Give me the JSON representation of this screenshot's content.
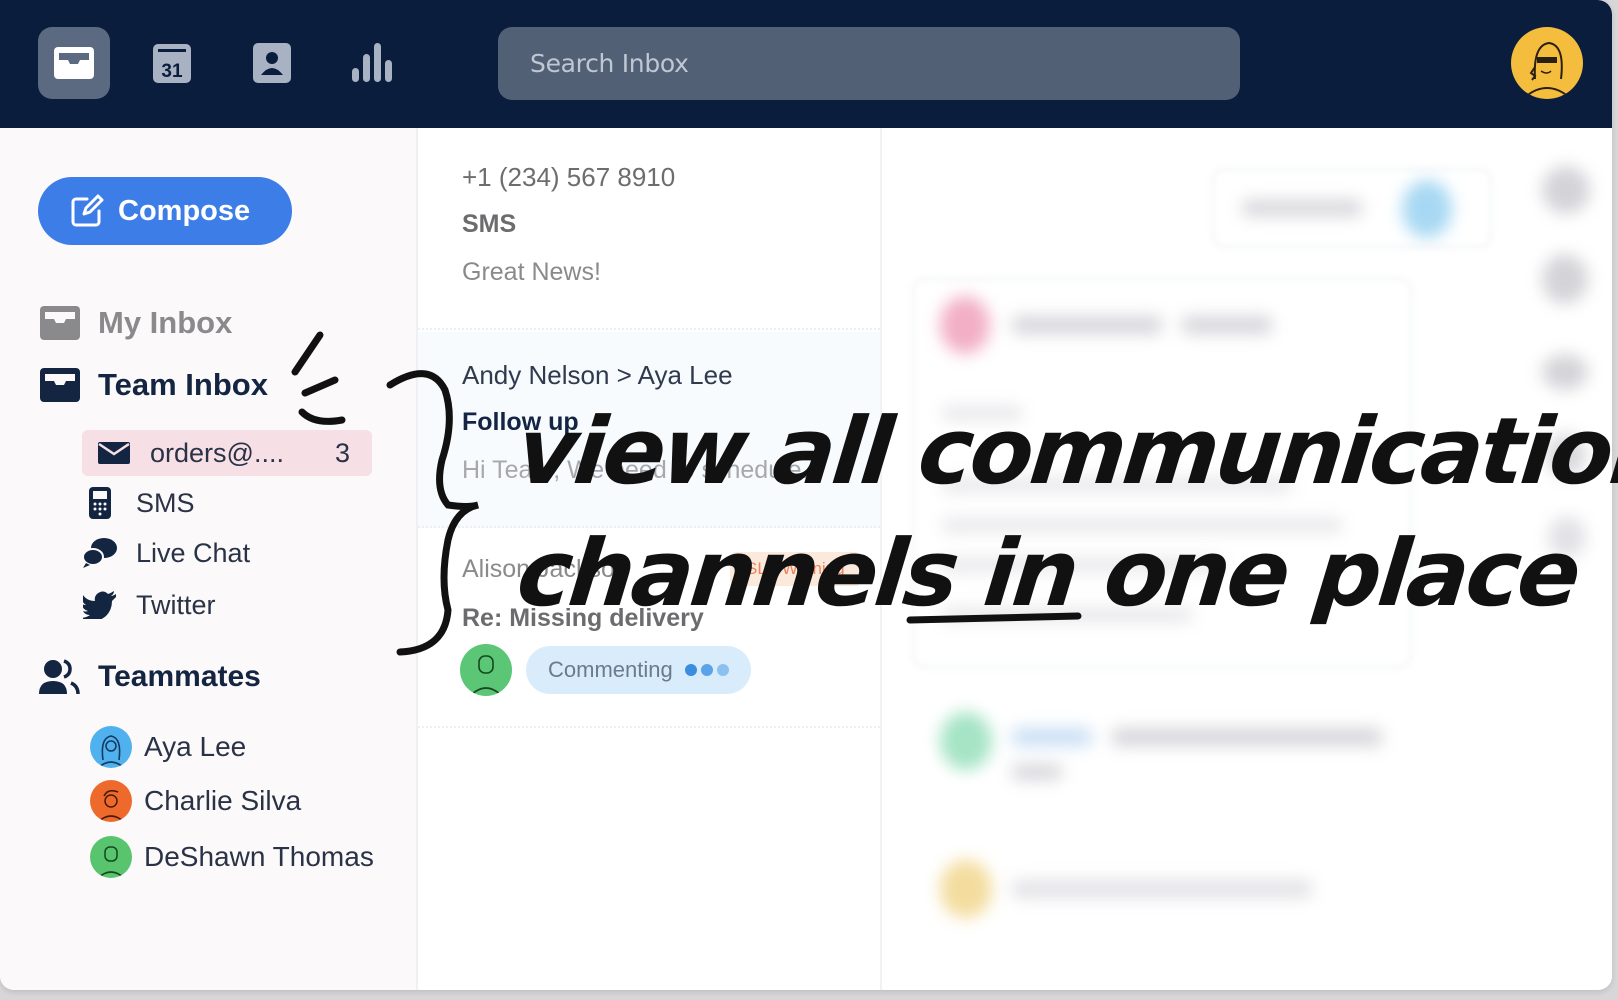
{
  "topbar": {
    "nav": [
      {
        "name": "inbox",
        "icon": "inbox-tray-icon",
        "active": true
      },
      {
        "name": "calendar",
        "icon": "calendar-icon",
        "day": "31",
        "active": false
      },
      {
        "name": "contacts",
        "icon": "contact-card-icon",
        "active": false
      },
      {
        "name": "analytics",
        "icon": "bar-chart-icon",
        "active": false
      }
    ],
    "search_placeholder": "Search Inbox",
    "user_avatar": "user-avatar-sunglasses"
  },
  "sidebar": {
    "compose_label": "Compose",
    "my_inbox_label": "My Inbox",
    "team_inbox_label": "Team Inbox",
    "channels": [
      {
        "label": "orders@....",
        "icon": "envelope-icon",
        "count": "3",
        "selected": true
      },
      {
        "label": "SMS",
        "icon": "phone-icon",
        "count": null,
        "selected": false
      },
      {
        "label": "Live Chat",
        "icon": "chat-bubbles-icon",
        "count": null,
        "selected": false
      },
      {
        "label": "Twitter",
        "icon": "twitter-bird-icon",
        "count": null,
        "selected": false
      }
    ],
    "teammates_label": "Teammates",
    "teammates": [
      {
        "name": "Aya Lee",
        "color": "#4fb2ee"
      },
      {
        "name": "Charlie Silva",
        "color": "#ee6a2c"
      },
      {
        "name": "DeShawn Thomas",
        "color": "#58c46e"
      }
    ]
  },
  "messages": [
    {
      "from": "+1 (234) 567 8910",
      "subject": "SMS",
      "preview": "Great News!"
    },
    {
      "from": "Andy Nelson > Aya Lee",
      "subject": "Follow up",
      "preview": "Hi Team, We need to schedule..."
    },
    {
      "from": "Alison Jackson",
      "subject": "Re: Missing delivery",
      "tag": "SLA Warning",
      "status": "Commenting"
    }
  ],
  "annotation": {
    "line1": "view all communication",
    "line2_a": "channels in ",
    "line2_emph": "one",
    "line2_b": " place"
  },
  "colors": {
    "topbar": "#0b1d3d",
    "accent": "#3d7de8",
    "selected_channel": "#f7dfe6",
    "avatar_user": "#f5bd3d",
    "sla_warning": "#e9774a"
  }
}
